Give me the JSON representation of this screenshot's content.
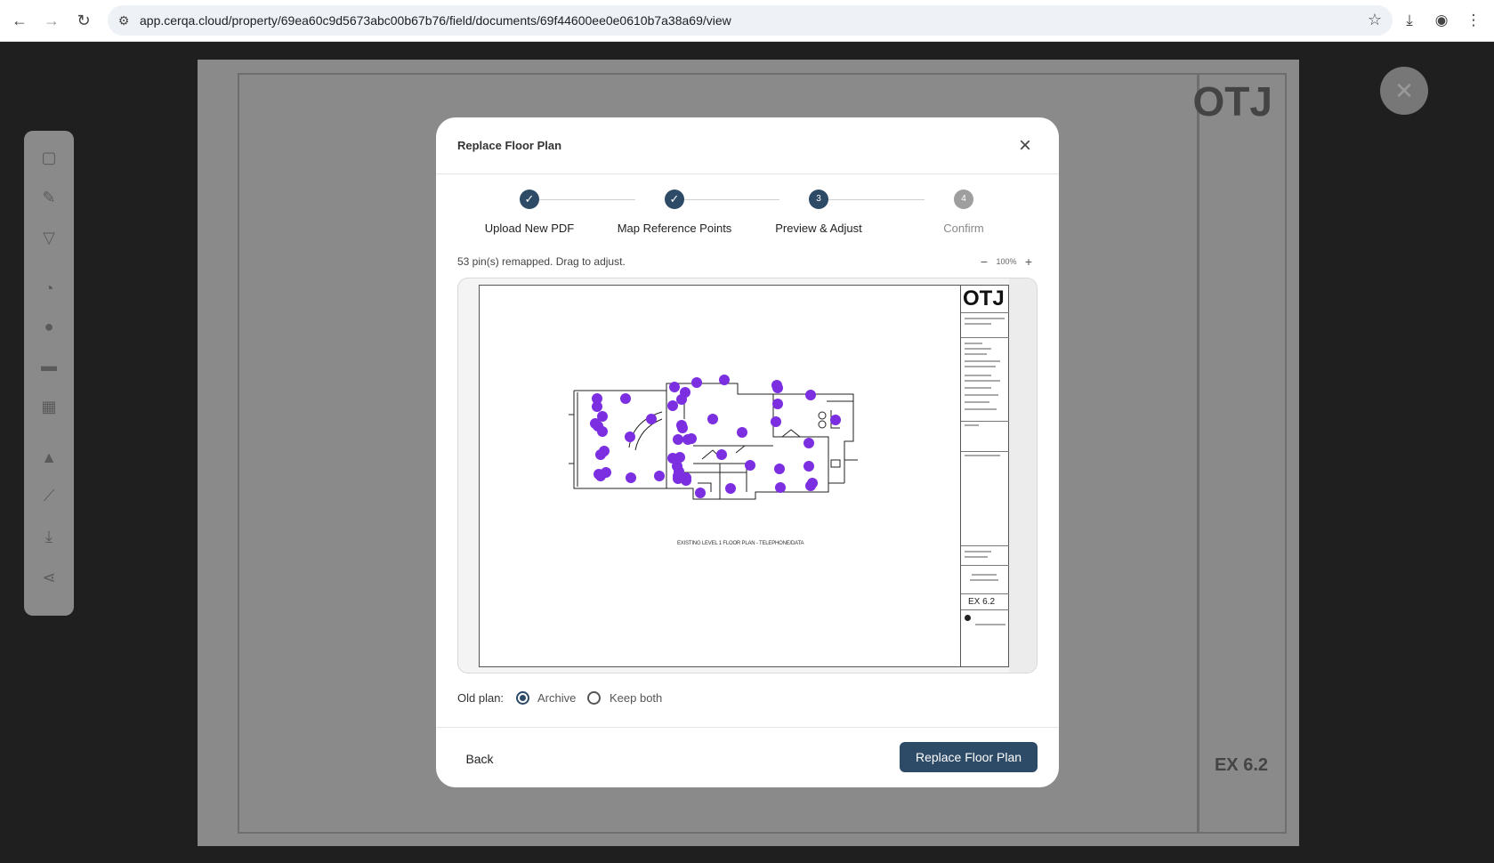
{
  "browser": {
    "url": "app.cerqa.cloud/property/69ea60c9d5673abc00b67b76/field/documents/69f44600ee0e0610b7a38a69/view",
    "icons": [
      "back-icon",
      "forward-icon",
      "reload-icon",
      "site-info-icon",
      "bookmark-star-icon",
      "download-icon",
      "profile-icon",
      "menu-dots-icon"
    ]
  },
  "background": {
    "sheet_logo": "OTJ",
    "sheet_number": "EX 6.2",
    "toolbar_icons": [
      "document-icon",
      "pen-icon",
      "filter-icon",
      "clock-icon",
      "layers-icon",
      "comment-icon",
      "grid-icon",
      "upload-icon",
      "ruler-icon",
      "download-icon",
      "share-icon"
    ]
  },
  "modal": {
    "title": "Replace Floor Plan",
    "steps": [
      {
        "label": "Upload New PDF",
        "state": "done",
        "mark": "✓"
      },
      {
        "label": "Map Reference Points",
        "state": "done",
        "mark": "✓"
      },
      {
        "label": "Preview & Adjust",
        "state": "active",
        "mark": "3"
      },
      {
        "label": "Confirm",
        "state": "pending",
        "mark": "4"
      }
    ],
    "info_text": "53 pin(s) remapped. Drag to adjust.",
    "zoom": {
      "minus": "−",
      "value": "100%",
      "plus": "+"
    },
    "preview": {
      "sheet_logo": "OTJ",
      "sheet_number": "EX 6.2",
      "plan_caption": "EXISTING LEVEL 1 FLOOR PLAN - TELEPHONE/DATA",
      "pin_color": "#7b2fe0",
      "pin_count": 53
    },
    "old_plan": {
      "label": "Old plan:",
      "options": [
        {
          "label": "Archive",
          "selected": true
        },
        {
          "label": "Keep both",
          "selected": false
        }
      ]
    },
    "footer": {
      "back_label": "Back",
      "primary_label": "Replace Floor Plan"
    }
  },
  "colors": {
    "primary": "#2d4a66",
    "pin": "#7b2fe0",
    "overlay": "#1e1e1e"
  }
}
